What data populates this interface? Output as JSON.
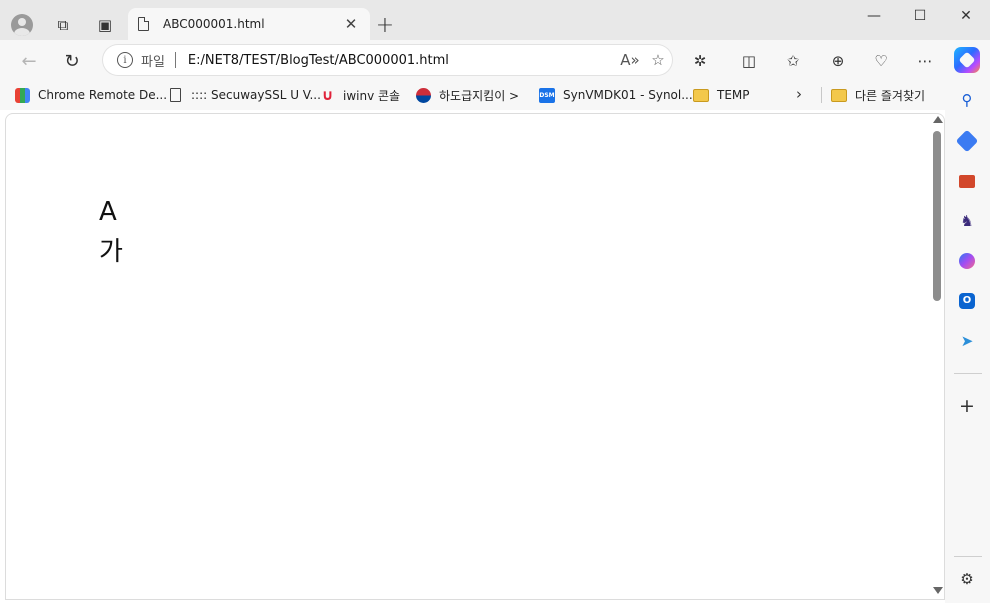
{
  "tab": {
    "title": "ABC000001.html"
  },
  "address": {
    "scheme": "파일",
    "url": "E:/NET8/TEST/BlogTest/ABC000001.html"
  },
  "favorites": [
    {
      "label": "Chrome Remote De...",
      "icon": "chrome-remote-desktop-icon"
    },
    {
      "label": ":::: SecuwaySSL U V...",
      "icon": "page-icon"
    },
    {
      "label": "iwinv 콘솔",
      "icon": "iwinv-icon"
    },
    {
      "label": "하도급지킴이 >",
      "icon": "taeguk-icon"
    },
    {
      "label": "SynVMDK01 - Synol...",
      "icon": "dsm-icon"
    },
    {
      "label": "TEMP",
      "icon": "folder-icon"
    },
    {
      "label": "다른 즐겨찾기",
      "icon": "folder-icon"
    }
  ],
  "page": {
    "line1": "A",
    "line2": "가"
  },
  "colors": {
    "chrome_bg": "#f7f7f7",
    "tabstrip_bg": "#e8e8e8",
    "content_bg": "#ffffff"
  }
}
